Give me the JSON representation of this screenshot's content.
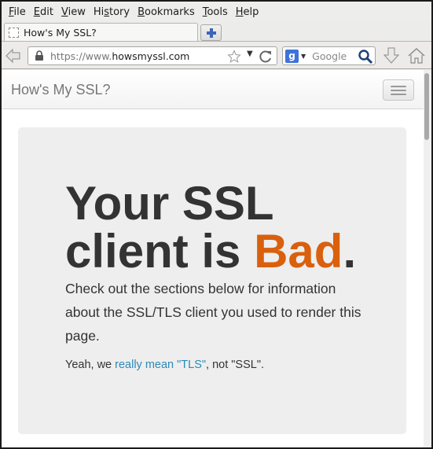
{
  "menubar": {
    "items": [
      {
        "accel": "F",
        "rest": "ile"
      },
      {
        "accel": "E",
        "rest": "dit"
      },
      {
        "accel": "V",
        "rest": "iew"
      },
      {
        "pre": "Hi",
        "accel": "s",
        "rest": "tory"
      },
      {
        "accel": "B",
        "rest": "ookmarks"
      },
      {
        "accel": "T",
        "rest": "ools"
      },
      {
        "accel": "H",
        "rest": "elp"
      }
    ]
  },
  "tab": {
    "title": "How's My SSL?"
  },
  "urlbar": {
    "scheme": "https://www.",
    "host": "howsmyssl.com"
  },
  "search": {
    "placeholder": "Google",
    "engine_letter": "g"
  },
  "site": {
    "brand": "How's My SSL?",
    "headline_part1": "Your SSL client is ",
    "rating": "Bad",
    "headline_end": ".",
    "lead": "Check out the sections below for information about the SSL/TLS client you used to render this page.",
    "note_pre": "Yeah, we ",
    "note_link": "really mean \"TLS\"",
    "note_post": ", not \"SSL\"."
  },
  "colors": {
    "rating": "#d9600d",
    "link": "#2a8ab8",
    "jumbotron": "#eeeeee"
  }
}
